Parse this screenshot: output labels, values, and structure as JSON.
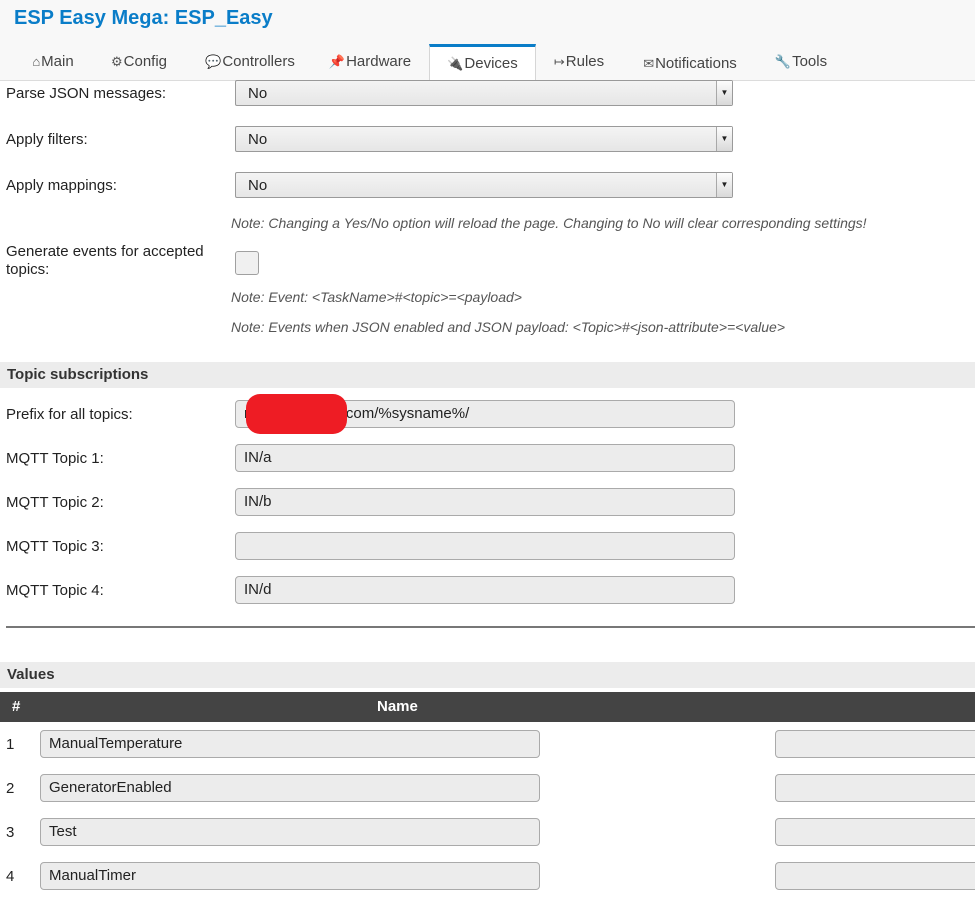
{
  "header": {
    "title": "ESP Easy Mega: ESP_Easy",
    "tabs": [
      {
        "icon": "⌂",
        "label": "Main"
      },
      {
        "icon": "⚙",
        "label": "Config"
      },
      {
        "icon": "💬",
        "label": "Controllers"
      },
      {
        "icon": "📌",
        "label": "Hardware"
      },
      {
        "icon": "🔌",
        "label": "Devices"
      },
      {
        "icon": "↦",
        "label": "Rules"
      },
      {
        "icon": "✉",
        "label": "Notifications"
      },
      {
        "icon": "🔧",
        "label": "Tools"
      }
    ],
    "active_tab": "Devices"
  },
  "settings": {
    "parse_json": {
      "label": "Parse JSON messages:",
      "value": "No"
    },
    "apply_filters": {
      "label": "Apply filters:",
      "value": "No"
    },
    "apply_mappings": {
      "label": "Apply mappings:",
      "value": "No"
    },
    "note_yesno": "Note: Changing a Yes/No option will reload the page. Changing to No will clear corresponding settings!",
    "generate_events": {
      "label": "Generate events for accepted topics:",
      "checked": false
    },
    "note_event": "Note: Event: <TaskName>#<topic>=<payload>",
    "note_json_event": "Note: Events when JSON enabled and JSON payload: <Topic>#<json-attribute>=<value>"
  },
  "topics": {
    "section_title": "Topic subscriptions",
    "prefix": {
      "label": "Prefix for all topics:",
      "value": "r          @gmail.com/%sysname%/"
    },
    "topic1": {
      "label": "MQTT Topic 1:",
      "value": "IN/a"
    },
    "topic2": {
      "label": "MQTT Topic 2:",
      "value": "IN/b"
    },
    "topic3": {
      "label": "MQTT Topic 3:",
      "value": ""
    },
    "topic4": {
      "label": "MQTT Topic 4:",
      "value": "IN/d"
    }
  },
  "values": {
    "section_title": "Values",
    "col_num": "#",
    "col_name": "Name",
    "rows": [
      {
        "num": "1",
        "name": "ManualTemperature"
      },
      {
        "num": "2",
        "name": "GeneratorEnabled"
      },
      {
        "num": "3",
        "name": "Test"
      },
      {
        "num": "4",
        "name": "ManualTimer"
      }
    ]
  }
}
